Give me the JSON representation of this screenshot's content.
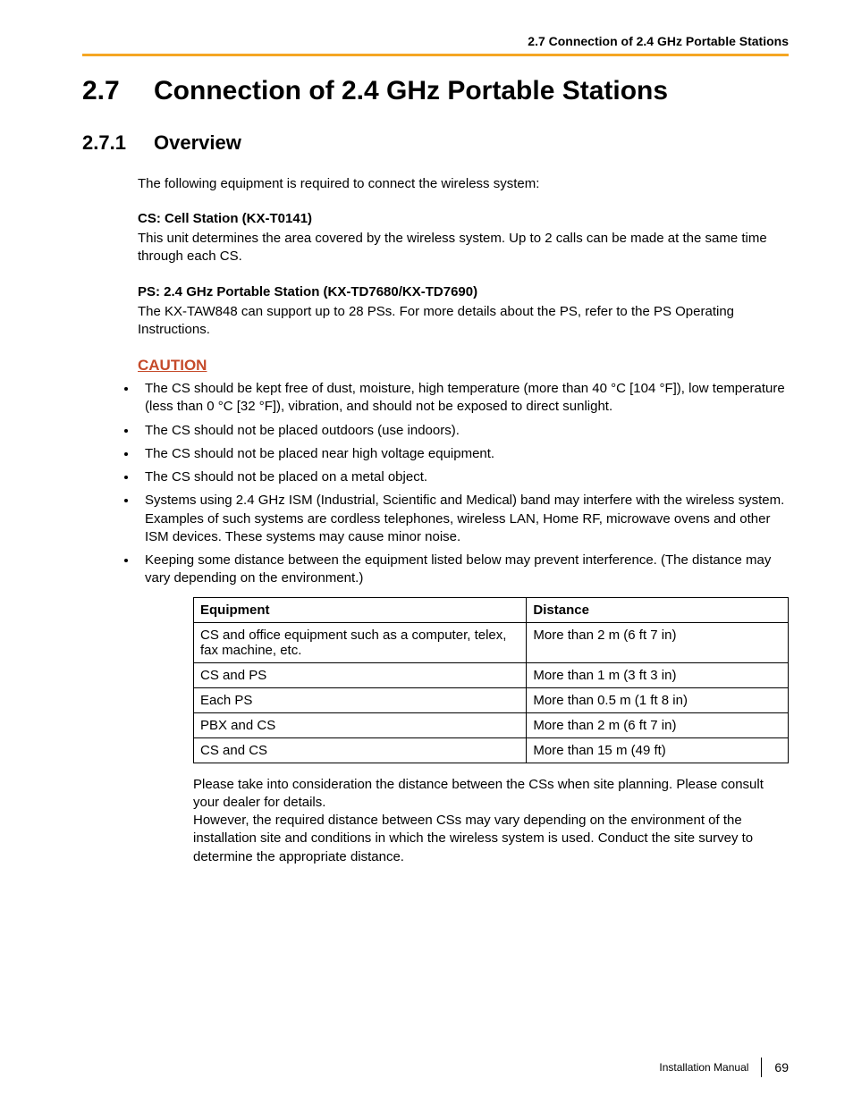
{
  "header": {
    "running": "2.7 Connection of 2.4 GHz Portable Stations"
  },
  "title": {
    "num": "2.7",
    "text": "Connection of 2.4 GHz Portable Stations"
  },
  "subsection": {
    "num": "2.7.1",
    "text": "Overview"
  },
  "intro": "The following equipment is required to connect the wireless system:",
  "equip1": {
    "heading": "CS: Cell Station (KX-T0141)",
    "body": "This unit determines the area covered by the wireless system. Up to 2 calls can be made at the same time through each CS."
  },
  "equip2": {
    "heading": "PS: 2.4 GHz Portable Station (KX-TD7680/KX-TD7690)",
    "body": "The KX-TAW848 can support up to 28 PSs. For more details about the PS, refer to the PS Operating Instructions."
  },
  "caution": {
    "heading": "CAUTION",
    "items": [
      "The CS should be kept free of dust, moisture, high temperature (more than 40 °C [104 °F]), low temperature (less than 0 °C [32 °F]), vibration, and should not be exposed to direct sunlight.",
      "The CS should not be placed outdoors (use indoors).",
      "The CS should not be placed near high voltage equipment.",
      "The CS should not be placed on a metal object.",
      "Systems using 2.4 GHz ISM (Industrial, Scientific and Medical) band may interfere with the wireless system. Examples of such systems are cordless telephones, wireless LAN, Home RF, microwave ovens and other ISM devices. These systems may cause minor noise.",
      "Keeping some distance between the equipment listed below may prevent interference. (The distance may vary depending on the environment.)"
    ]
  },
  "table": {
    "headers": {
      "c1": "Equipment",
      "c2": "Distance"
    },
    "rows": [
      {
        "c1": "CS and office equipment such as a computer, telex, fax machine, etc.",
        "c2": "More than 2 m (6 ft 7 in)"
      },
      {
        "c1": "CS and PS",
        "c2": "More than 1 m (3 ft 3 in)"
      },
      {
        "c1": "Each PS",
        "c2": "More than 0.5 m (1 ft 8 in)"
      },
      {
        "c1": "PBX and CS",
        "c2": "More than 2 m (6 ft 7 in)"
      },
      {
        "c1": "CS and CS",
        "c2": "More than 15 m (49 ft)"
      }
    ]
  },
  "after_table": {
    "p1": "Please take into consideration the distance between the CSs when site planning. Please consult your dealer for details.",
    "p2": "However, the required distance between CSs may vary depending on the environment of the installation site and conditions in which the wireless system is used. Conduct the site survey to determine the appropriate distance."
  },
  "footer": {
    "label": "Installation Manual",
    "page": "69"
  }
}
